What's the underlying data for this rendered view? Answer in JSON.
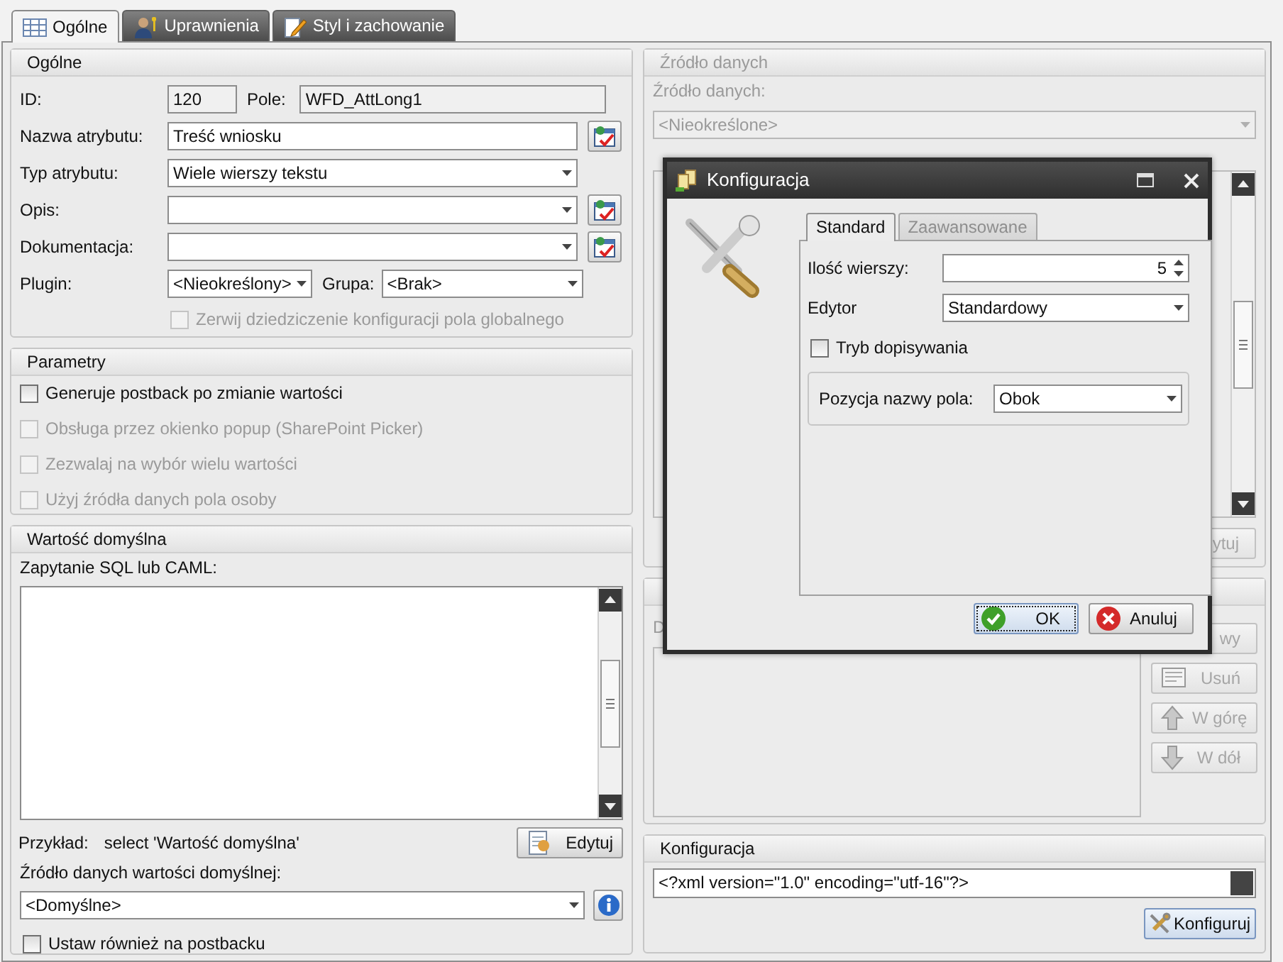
{
  "tabs": [
    {
      "label": "Ogólne",
      "kind": "grid",
      "selected": true
    },
    {
      "label": "Uprawnienia",
      "kind": "person",
      "selected": false
    },
    {
      "label": "Styl i zachowanie",
      "kind": "pencil",
      "selected": false
    }
  ],
  "general": {
    "title": "Ogólne",
    "id_label": "ID:",
    "id_value": "120",
    "field_label": "Pole:",
    "field_value": "WFD_AttLong1",
    "rows": [
      {
        "label": "Nazwa atrybutu:",
        "kind": "text",
        "value": "Treść wniosku",
        "edit_button": true
      },
      {
        "label": "Typ atrybutu:",
        "kind": "select",
        "value": "Wiele wierszy tekstu",
        "edit_button": false
      },
      {
        "label": "Opis:",
        "kind": "select",
        "edit_button": true
      },
      {
        "label": "Dokumentacja:",
        "kind": "select",
        "edit_button": true
      }
    ],
    "plugin_label": "Plugin:",
    "plugin_value": "<Nieokreślony>",
    "group_label": "Grupa:",
    "group_value": "<Brak>",
    "inherit": {
      "label": "Zerwij dziedziczenie konfiguracji pola globalnego",
      "checked": false,
      "disabled": true
    }
  },
  "parameters": {
    "title": "Parametry",
    "options": [
      {
        "label": "Generuje postback po zmianie wartości",
        "checked": false,
        "disabled": false
      },
      {
        "label": "Obsługa przez okienko popup (SharePoint Picker)",
        "checked": false,
        "disabled": true
      },
      {
        "label": "Zezwalaj na wybór wielu wartości",
        "checked": false,
        "disabled": true
      },
      {
        "label": "Użyj źródła danych pola osoby",
        "checked": false,
        "disabled": true
      }
    ]
  },
  "default_value": {
    "title": "Wartość domyślna",
    "query_label": "Zapytanie SQL lub CAML:",
    "example_label": "Przykład:",
    "example_value": "select 'Wartość domyślna'",
    "edit_button": "Edytuj",
    "source_label": "Źródło danych wartości domyślnej:",
    "source_value": "<Domyślne>",
    "postback": {
      "label": "Ustaw również na postbacku",
      "checked": false
    }
  },
  "data_source": {
    "title": "Źródło danych",
    "disabled": true,
    "source_label": "Źródło danych:",
    "source_value": "<Nieokreślone>",
    "edit_button": "ytuj"
  },
  "list_group": {
    "list_label": "D",
    "buttons": [
      {
        "label": "wy",
        "kind": "none",
        "disabled": true
      },
      {
        "label": "Usuń",
        "kind": "remove",
        "disabled": true
      },
      {
        "label": "W górę",
        "kind": "up",
        "disabled": true
      },
      {
        "label": "W dół",
        "kind": "down",
        "disabled": true
      }
    ]
  },
  "configuration": {
    "title": "Konfiguracja",
    "value": "<?xml version=\"1.0\" encoding=\"utf-16\"?>",
    "button": "Konfiguruj"
  },
  "dialog": {
    "title": "Konfiguracja",
    "tabs": [
      {
        "label": "Standard",
        "selected": true,
        "disabled": false
      },
      {
        "label": "Zaawansowane",
        "selected": false,
        "disabled": true
      }
    ],
    "rows_label": "Ilość wierszy:",
    "rows_value": "5",
    "editor_label": "Edytor",
    "editor_value": "Standardowy",
    "append": {
      "label": "Tryb dopisywania",
      "checked": false
    },
    "position_label": "Pozycja nazwy pola:",
    "position_value": "Obok",
    "buttons": [
      {
        "label": "OK",
        "kind": "ok",
        "focused": true
      },
      {
        "label": "Anuluj",
        "kind": "cancel",
        "focused": false
      }
    ]
  }
}
